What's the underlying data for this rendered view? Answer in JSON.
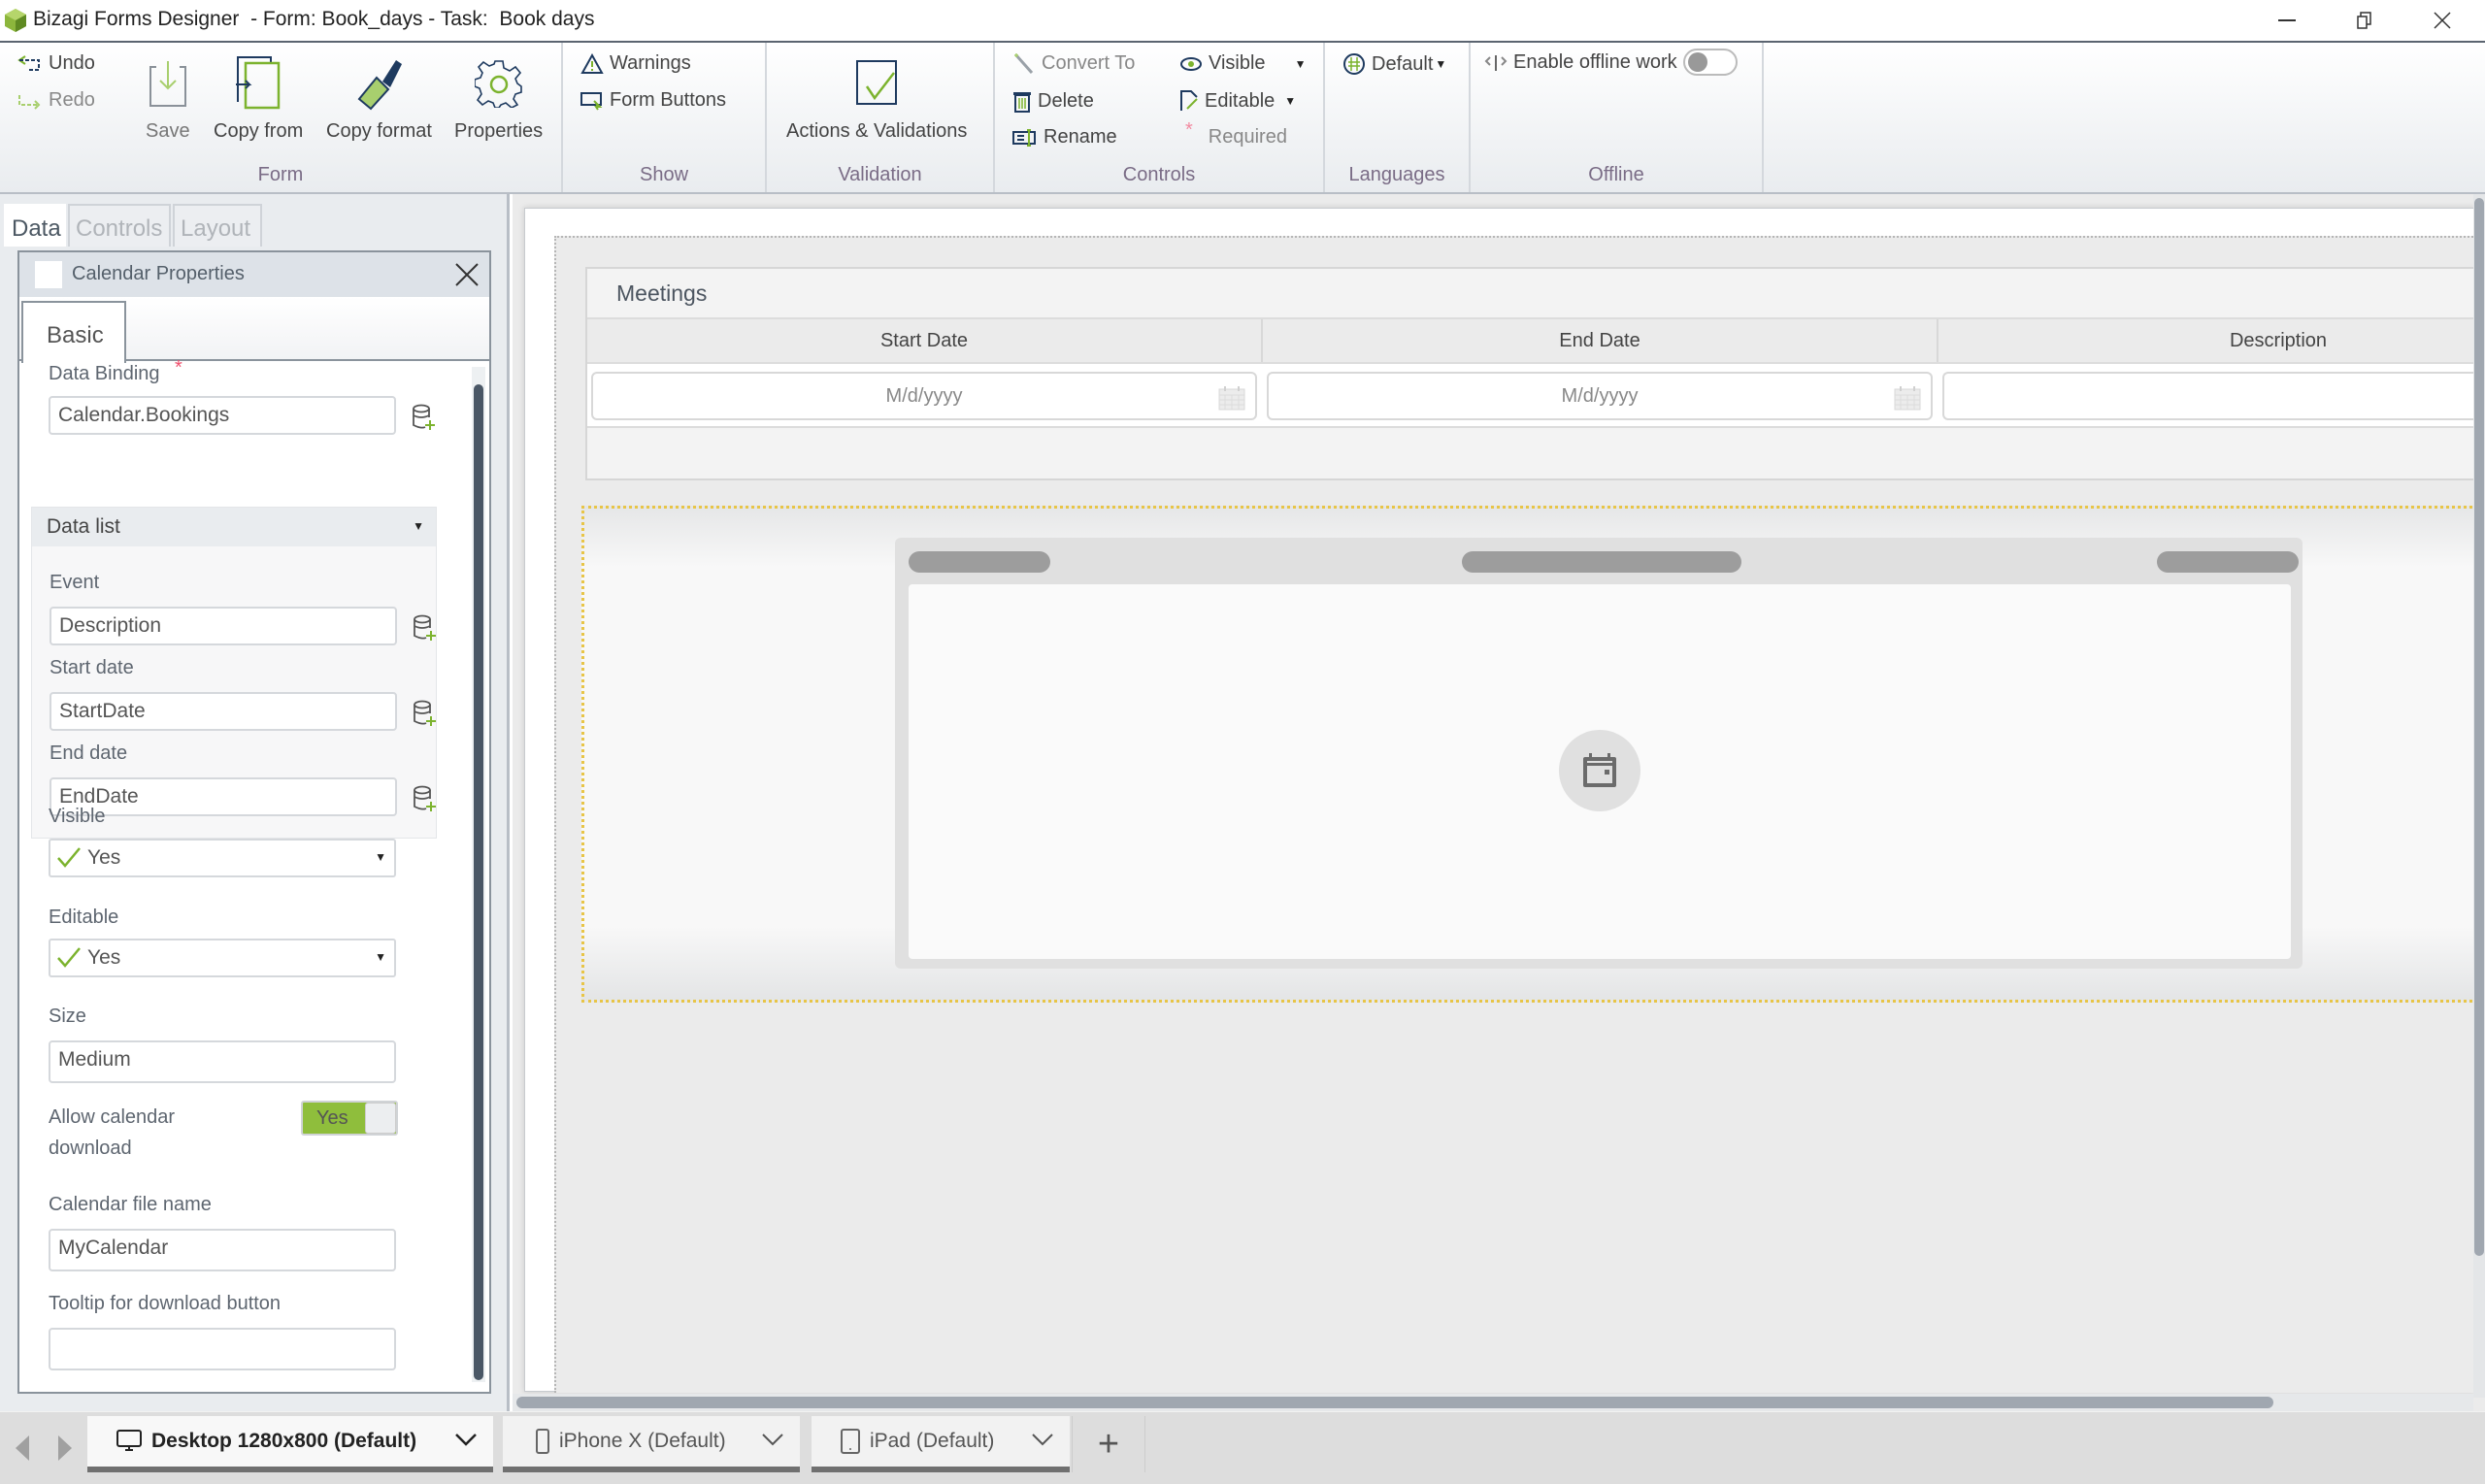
{
  "window": {
    "title": "Bizagi Forms Designer  - Form: Book_days - Task:  Book days",
    "controls": {
      "minimize": "minimize-icon",
      "restore": "restore-icon",
      "close": "close-icon"
    }
  },
  "ribbon": {
    "groups": {
      "form": {
        "label": "Form",
        "undo": "Undo",
        "redo": "Redo",
        "save": "Save",
        "copy_from": "Copy from",
        "copy_format": "Copy format",
        "properties": "Properties"
      },
      "show": {
        "label": "Show",
        "warnings": "Warnings",
        "form_buttons": "Form Buttons"
      },
      "validation": {
        "label": "Validation",
        "actions_validations": "Actions & Validations"
      },
      "controls": {
        "label": "Controls",
        "convert_to": "Convert To",
        "delete": "Delete",
        "rename": "Rename",
        "visible": "Visible",
        "editable": "Editable",
        "required": "Required"
      },
      "languages": {
        "label": "Languages",
        "default": "Default"
      },
      "offline": {
        "label": "Offline",
        "enable_offline": "Enable offline work",
        "enabled": false
      }
    }
  },
  "left_pane": {
    "tabs": [
      {
        "label": "Data",
        "active": true
      },
      {
        "label": "Controls",
        "active": false
      },
      {
        "label": "Layout",
        "active": false
      }
    ],
    "properties_panel": {
      "title": "Calendar Properties",
      "tabs": [
        {
          "label": "Basic",
          "active": true
        }
      ],
      "data_binding": {
        "label": "Data Binding",
        "required_marker": "*",
        "value": "Calendar.Bookings"
      },
      "data_list": {
        "label": "Data list",
        "event": {
          "label": "Event",
          "value": "Description"
        },
        "start_date": {
          "label": "Start date",
          "value": "StartDate"
        },
        "end_date": {
          "label": "End date",
          "value": "EndDate"
        }
      },
      "visible": {
        "label": "Visible",
        "value": "Yes"
      },
      "editable": {
        "label": "Editable",
        "value": "Yes"
      },
      "size": {
        "label": "Size",
        "value": "Medium"
      },
      "allow_download": {
        "label_line1": "Allow calendar",
        "label_line2": "download",
        "value": "Yes",
        "on": true
      },
      "calendar_file_name": {
        "label": "Calendar file name",
        "value": "MyCalendar"
      },
      "tooltip_download": {
        "label": "Tooltip for download button",
        "value": ""
      }
    }
  },
  "canvas": {
    "grid": {
      "title": "Meetings",
      "columns": [
        "Start Date",
        "End Date",
        "Description"
      ],
      "row": [
        "M/d/yyyy",
        "M/d/yyyy",
        ""
      ]
    },
    "calendar_control": {
      "icon": "calendar-icon"
    }
  },
  "device_tabs": [
    {
      "label": "Desktop 1280x800 (Default)",
      "icon": "monitor-icon",
      "active": true
    },
    {
      "label": "iPhone X (Default)",
      "icon": "phone-icon",
      "active": false
    },
    {
      "label": "iPad (Default)",
      "icon": "tablet-icon",
      "active": false
    }
  ],
  "add_device_label": "+"
}
